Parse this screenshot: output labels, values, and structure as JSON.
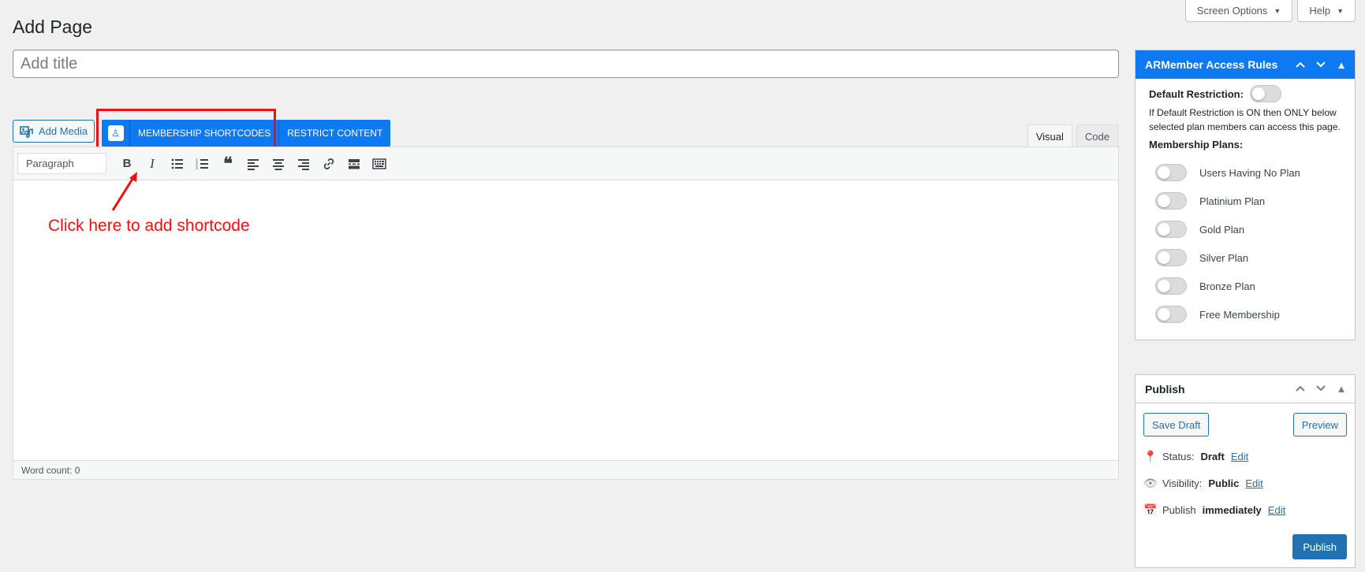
{
  "header": {
    "screen_options": "Screen Options",
    "help": "Help",
    "page_title": "Add Page"
  },
  "title_field": {
    "placeholder": "Add title",
    "value": ""
  },
  "media": {
    "add_media": "Add Media"
  },
  "plugin_bar": {
    "membership_shortcodes": "MEMBERSHIP SHORTCODES",
    "restrict_content": "RESTRICT CONTENT"
  },
  "editor": {
    "tab_visual": "Visual",
    "tab_code": "Code",
    "format": "Paragraph",
    "word_count": "Word count: 0"
  },
  "annotation": {
    "text": "Click here to add shortcode",
    "color": "#ee1111"
  },
  "armember": {
    "title": "ARMember Access Rules",
    "default_restriction_label": "Default Restriction:",
    "description": "If Default Restriction is ON then ONLY below selected plan members can access this page.",
    "plans_label": "Membership Plans:",
    "plans": [
      "Users Having No Plan",
      "Platinium Plan",
      "Gold Plan",
      "Silver Plan",
      "Bronze Plan",
      "Free Membership"
    ]
  },
  "publish": {
    "title": "Publish",
    "save_draft": "Save Draft",
    "preview": "Preview",
    "status_label": "Status:",
    "status_value": "Draft",
    "visibility_label": "Visibility:",
    "visibility_value": "Public",
    "publish_label": "Publish",
    "publish_value": "immediately",
    "edit": "Edit",
    "publish_button": "Publish"
  },
  "colors": {
    "accent": "#2271b1",
    "plugin_blue": "#0d79f2",
    "annotation_red": "#ee1111"
  }
}
